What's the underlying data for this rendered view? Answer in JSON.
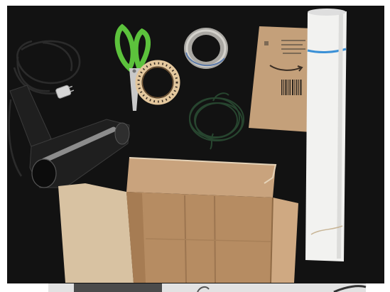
{
  "scene": {
    "colors": {
      "frame": "#ffffff",
      "table": "#121212",
      "cord": "#2b2b2b",
      "dryer_body": "#1f1f1f",
      "dryer_accent": "#8c8c8c",
      "scissors_handle": "#5cc23c",
      "scissors_blade": "#c9c9c9",
      "hoop": "#e3c79d",
      "tape": "#aaa8a3",
      "wire": "#27452f",
      "cardboard": "#c4a07a",
      "paper_roll": "#f2f2f0",
      "band": "#3a90d6",
      "box_flap": "#c9a37d",
      "box_inner": "#b68c62",
      "box_left_flap": "#d8c2a2",
      "box_right_flap": "#cfa982",
      "strip_light": "#e2e2e2",
      "strip_dark": "#4b4b4b"
    }
  }
}
